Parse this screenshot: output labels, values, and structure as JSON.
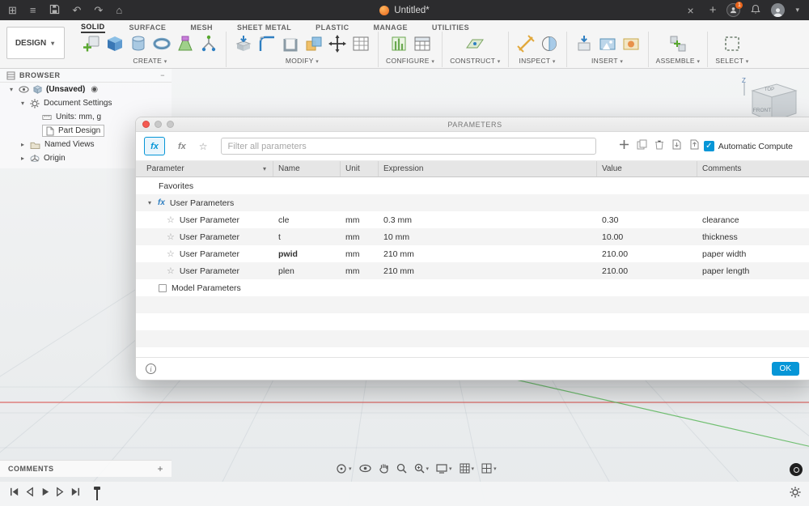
{
  "icons": {
    "apps": "⊞",
    "menu": "≡",
    "undo": "↶",
    "redo": "↷",
    "home": "⌂",
    "close": "×",
    "plus": "+",
    "chevron_down": "▾",
    "caret_down": "▾",
    "caret_right": "▸",
    "minus": "−",
    "record": "◉",
    "star": "☆",
    "fx": "fx",
    "check": "✓",
    "info": "i",
    "collab_count": "1"
  },
  "titlebar": {
    "title": "Untitled*"
  },
  "ribbon": {
    "design_label": "DESIGN",
    "tabs": [
      {
        "label": "SOLID"
      },
      {
        "label": "SURFACE"
      },
      {
        "label": "MESH"
      },
      {
        "label": "SHEET METAL"
      },
      {
        "label": "PLASTIC"
      },
      {
        "label": "MANAGE"
      },
      {
        "label": "UTILITIES"
      }
    ],
    "groups": [
      {
        "label": "CREATE"
      },
      {
        "label": "MODIFY"
      },
      {
        "label": "CONFIGURE"
      },
      {
        "label": "CONSTRUCT"
      },
      {
        "label": "INSPECT"
      },
      {
        "label": "INSERT"
      },
      {
        "label": "ASSEMBLE"
      },
      {
        "label": "SELECT"
      }
    ]
  },
  "browser": {
    "title": "BROWSER",
    "root": "(Unsaved)",
    "items": [
      {
        "label": "Document Settings"
      },
      {
        "label": "Units: mm, g"
      },
      {
        "label": "Part Design"
      },
      {
        "label": "Named Views"
      },
      {
        "label": "Origin"
      }
    ]
  },
  "viewcube": {
    "axis": "Z",
    "top": "TOP",
    "front": "FRONT"
  },
  "dialog": {
    "title": "PARAMETERS",
    "search_placeholder": "Filter all parameters",
    "auto_compute_label": "Automatic Compute",
    "columns": {
      "parameter": "Parameter",
      "name": "Name",
      "unit": "Unit",
      "expression": "Expression",
      "value": "Value",
      "comments": "Comments"
    },
    "sections": {
      "favorites": "Favorites",
      "user_parameters": "User Parameters",
      "model_parameters": "Model Parameters"
    },
    "rows": [
      {
        "parameter": "User Parameter",
        "name": "cle",
        "unit": "mm",
        "expression": "0.3 mm",
        "value": "0.30",
        "comments": "clearance"
      },
      {
        "parameter": "User Parameter",
        "name": "t",
        "unit": "mm",
        "expression": "10 mm",
        "value": "10.00",
        "comments": "thickness"
      },
      {
        "parameter": "User Parameter",
        "name": "pwid",
        "unit": "mm",
        "expression": "210 mm",
        "value": "210.00",
        "comments": "paper width"
      },
      {
        "parameter": "User Parameter",
        "name": "plen",
        "unit": "mm",
        "expression": "210 mm",
        "value": "210.00",
        "comments": "paper length"
      }
    ],
    "ok_label": "OK"
  },
  "comments_panel": {
    "title": "COMMENTS"
  },
  "colors": {
    "accent": "#0696d7"
  }
}
